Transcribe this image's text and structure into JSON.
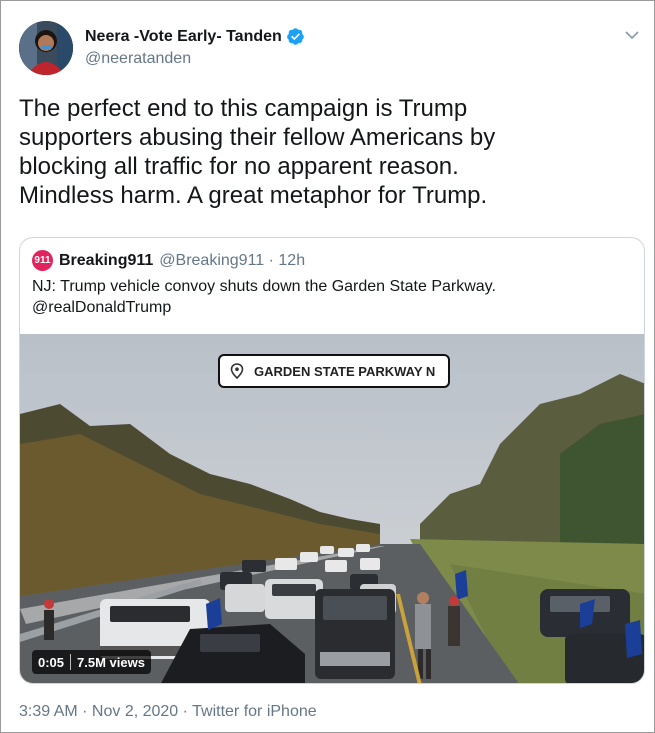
{
  "tweet": {
    "author": {
      "display_name": "Neera -Vote Early- Tanden",
      "handle": "@neeratanden",
      "verified": true
    },
    "text_lines": [
      "The perfect end to this campaign is Trump",
      "supporters abusing their fellow Americans by",
      "blocking all traffic for no apparent reason.",
      "Mindless harm. A great metaphor for Trump."
    ],
    "meta": "3:39 AM · Nov 2, 2020 · Twitter for iPhone"
  },
  "quoted": {
    "avatar_text": "911",
    "display_name": "Breaking911",
    "handle": "@Breaking911 · 12h",
    "text_lines": [
      "NJ: Trump vehicle convoy shuts down the Garden State Parkway.",
      "@realDonaldTrump"
    ],
    "media": {
      "location_label": "GARDEN STATE PARKWAY N",
      "duration": "0:05",
      "views": "7.5M views"
    }
  },
  "icons": {
    "verified": "verified-badge-icon",
    "caret": "chevron-down-icon",
    "pin": "location-pin-icon"
  },
  "colors": {
    "verified_blue": "#1da1f2",
    "secondary_text": "#657786",
    "breaking911_red": "#e0245e"
  }
}
